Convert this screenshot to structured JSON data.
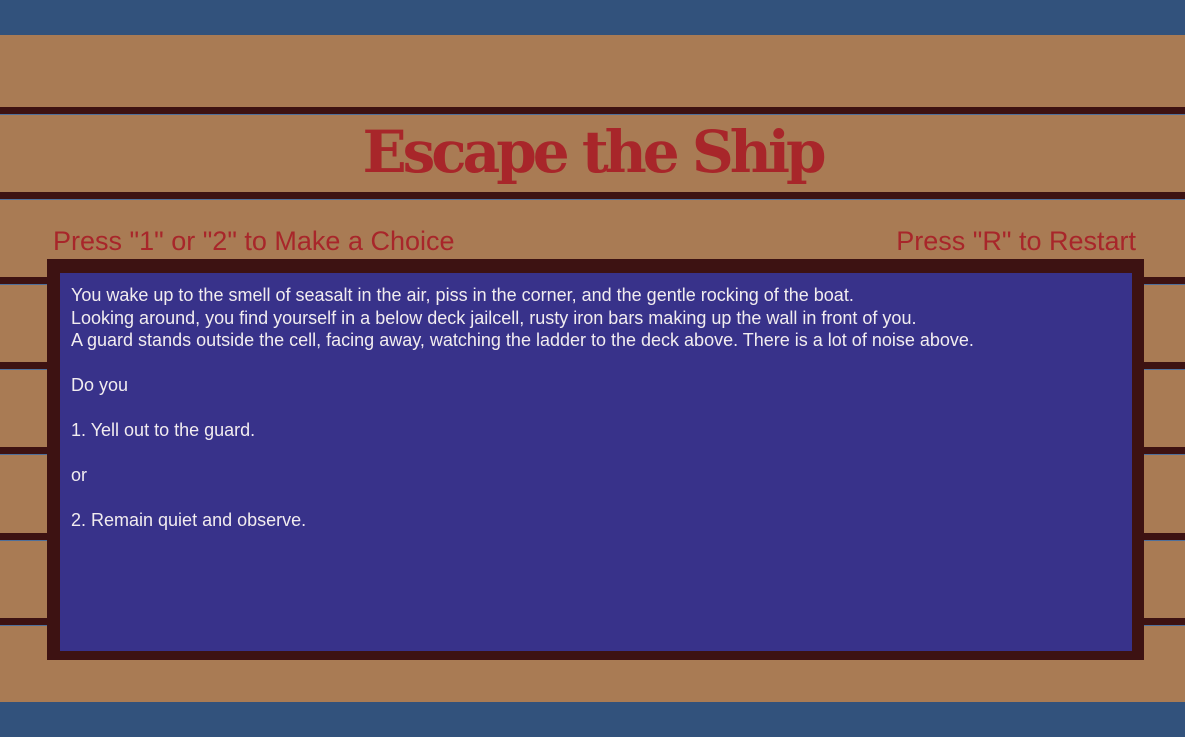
{
  "game": {
    "title": "Escape the Ship",
    "choice_hint": "Press \"1\" or \"2\" to Make a Choice",
    "restart_hint": "Press \"R\" to Restart"
  },
  "story": {
    "text": "You wake up to the smell of seasalt in the air, piss in the corner, and the gentle rocking of the boat.\nLooking around, you find yourself in a below deck jailcell, rusty iron bars making up the wall in front of you.\nA guard stands outside the cell, facing away, watching the ladder to the deck above. There is a lot of noise above.\n\nDo you\n\n1. Yell out to the guard.\n\nor\n\n2. Remain quiet and observe."
  },
  "colors": {
    "sky_blue": "#32527c",
    "wood": "#a97b54",
    "dark_trim": "#3d1212",
    "title_red": "#a8262a",
    "panel_blue": "#38328a",
    "panel_text": "#f1ecef"
  }
}
